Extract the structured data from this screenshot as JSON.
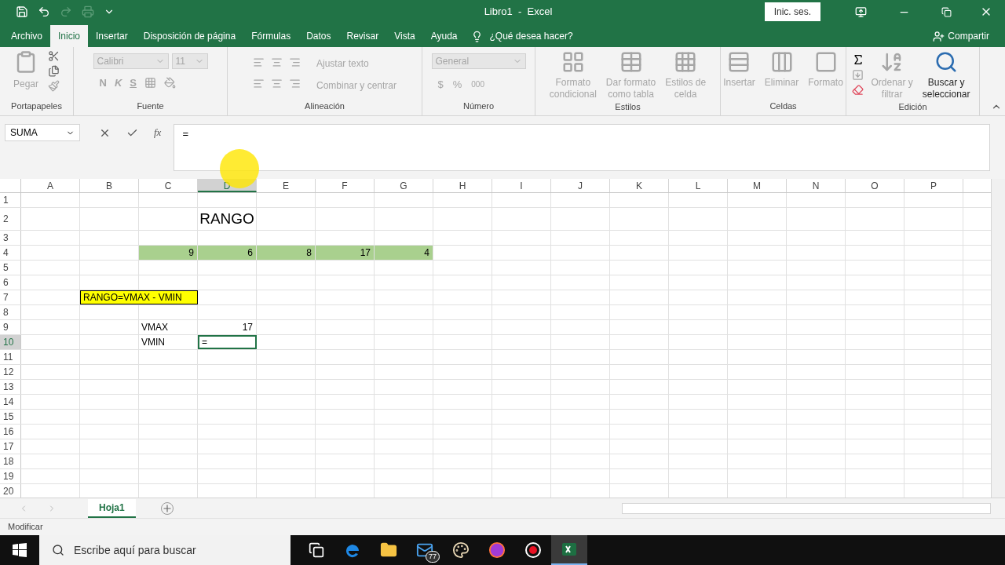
{
  "title_bar": {
    "title": "Libro1  -  Excel",
    "sign_in": "Inic. ses."
  },
  "tabs": [
    {
      "label": "Archivo",
      "selected": false
    },
    {
      "label": "Inicio",
      "selected": true
    },
    {
      "label": "Insertar",
      "selected": false
    },
    {
      "label": "Disposición de página",
      "selected": false
    },
    {
      "label": "Fórmulas",
      "selected": false
    },
    {
      "label": "Datos",
      "selected": false
    },
    {
      "label": "Revisar",
      "selected": false
    },
    {
      "label": "Vista",
      "selected": false
    },
    {
      "label": "Ayuda",
      "selected": false
    }
  ],
  "tell_me": "¿Qué desea hacer?",
  "share": "Compartir",
  "ribbon": {
    "clipboard": {
      "label": "Portapapeles",
      "paste": "Pegar"
    },
    "font": {
      "label": "Fuente",
      "font": "Calibri",
      "size": "11",
      "bold": "N",
      "italic": "K",
      "underline": "S"
    },
    "alignment": {
      "label": "Alineación",
      "wrap": "Ajustar texto",
      "merge": "Combinar y centrar"
    },
    "number": {
      "label": "Número",
      "format": "General",
      "currency": "$",
      "percent": "%",
      "thousands": "000"
    },
    "styles": {
      "label": "Estilos",
      "buttons": [
        {
          "lines": [
            "Formato",
            "condicional"
          ],
          "disabled": true
        },
        {
          "lines": [
            "Dar formato",
            "como tabla"
          ],
          "disabled": true
        },
        {
          "lines": [
            "Estilos de",
            "celda"
          ],
          "disabled": true
        }
      ]
    },
    "cells": {
      "label": "Celdas",
      "buttons": [
        {
          "lines": [
            "Insertar"
          ],
          "disabled": true
        },
        {
          "lines": [
            "Eliminar"
          ],
          "disabled": true
        },
        {
          "lines": [
            "Formato"
          ],
          "disabled": true
        }
      ]
    },
    "editing": {
      "label": "Edición",
      "buttons": [
        {
          "lines": [
            "Ordenar y",
            "filtrar"
          ],
          "disabled": true
        },
        {
          "lines": [
            "Buscar y",
            "seleccionar"
          ],
          "disabled": false
        }
      ]
    }
  },
  "formula_bar": {
    "name_box": "SUMA",
    "function": "fx",
    "value": "="
  },
  "sheet": {
    "columns": [
      {
        "label": "A",
        "selected": false
      },
      {
        "label": "B",
        "selected": false
      },
      {
        "label": "C",
        "selected": false
      },
      {
        "label": "D",
        "selected": true
      },
      {
        "label": "E",
        "selected": false
      },
      {
        "label": "F",
        "selected": false
      },
      {
        "label": "G",
        "selected": false
      },
      {
        "label": "H",
        "selected": false
      },
      {
        "label": "I",
        "selected": false
      },
      {
        "label": "J",
        "selected": false
      },
      {
        "label": "K",
        "selected": false
      },
      {
        "label": "L",
        "selected": false
      },
      {
        "label": "M",
        "selected": false
      },
      {
        "label": "N",
        "selected": false
      },
      {
        "label": "O",
        "selected": false
      },
      {
        "label": "P",
        "selected": false
      }
    ],
    "rows": [
      {
        "label": "1",
        "selected": false
      },
      {
        "label": "2",
        "selected": false,
        "cells": [
          {
            "kind": "empty"
          },
          {
            "kind": "empty"
          },
          {
            "kind": "empty"
          },
          {
            "kind": "title",
            "text": "RANGO",
            "selected": false
          }
        ]
      },
      {
        "label": "3",
        "selected": false
      },
      {
        "label": "4",
        "selected": false,
        "cells": [
          {
            "kind": "empty"
          },
          {
            "kind": "empty"
          },
          {
            "kind": "green",
            "text": "9",
            "selected": false
          },
          {
            "kind": "green",
            "text": "6",
            "selected": false
          },
          {
            "kind": "green",
            "text": "8",
            "selected": false
          },
          {
            "kind": "green",
            "text": "17",
            "selected": false
          },
          {
            "kind": "green",
            "text": "4",
            "selected": false
          }
        ]
      },
      {
        "label": "5",
        "selected": false
      },
      {
        "label": "6",
        "selected": false
      },
      {
        "label": "7",
        "selected": false,
        "cells": [
          {
            "kind": "empty"
          },
          {
            "kind": "yellow_box",
            "text": "RANGO=VMAX - VMIN",
            "selected": false
          }
        ]
      },
      {
        "label": "8",
        "selected": false
      },
      {
        "label": "9",
        "selected": false,
        "cells": [
          {
            "kind": "empty"
          },
          {
            "kind": "empty"
          },
          {
            "kind": "label",
            "text": "VMAX",
            "selected": false
          },
          {
            "kind": "number",
            "text": "17",
            "selected": false
          }
        ]
      },
      {
        "label": "10",
        "selected": true,
        "cells": [
          {
            "kind": "empty"
          },
          {
            "kind": "empty"
          },
          {
            "kind": "label",
            "text": "VMIN",
            "selected": false
          },
          {
            "kind": "label",
            "text": "=",
            "selected": true
          }
        ]
      },
      {
        "label": "11",
        "selected": false
      },
      {
        "label": "12",
        "selected": false
      },
      {
        "label": "13",
        "selected": false
      },
      {
        "label": "14",
        "selected": false
      },
      {
        "label": "15",
        "selected": false
      },
      {
        "label": "16",
        "selected": false
      },
      {
        "label": "17",
        "selected": false
      },
      {
        "label": "18",
        "selected": false
      },
      {
        "label": "19",
        "selected": false
      },
      {
        "label": "20",
        "selected": false
      }
    ]
  },
  "sheet_tabs": [
    {
      "label": "Hoja1",
      "selected": true
    }
  ],
  "status": "Modificar",
  "taskbar": {
    "search_placeholder": "Escribe aquí para buscar",
    "apps": [
      {
        "kind": "taskview",
        "selected": false
      },
      {
        "kind": "edge",
        "selected": false
      },
      {
        "kind": "folder",
        "selected": false
      },
      {
        "kind": "mail",
        "badge": "77",
        "selected": false
      },
      {
        "kind": "paint",
        "selected": false
      },
      {
        "kind": "firefox",
        "selected": false
      },
      {
        "kind": "record",
        "selected": false
      },
      {
        "kind": "excel",
        "selected": true
      }
    ]
  }
}
